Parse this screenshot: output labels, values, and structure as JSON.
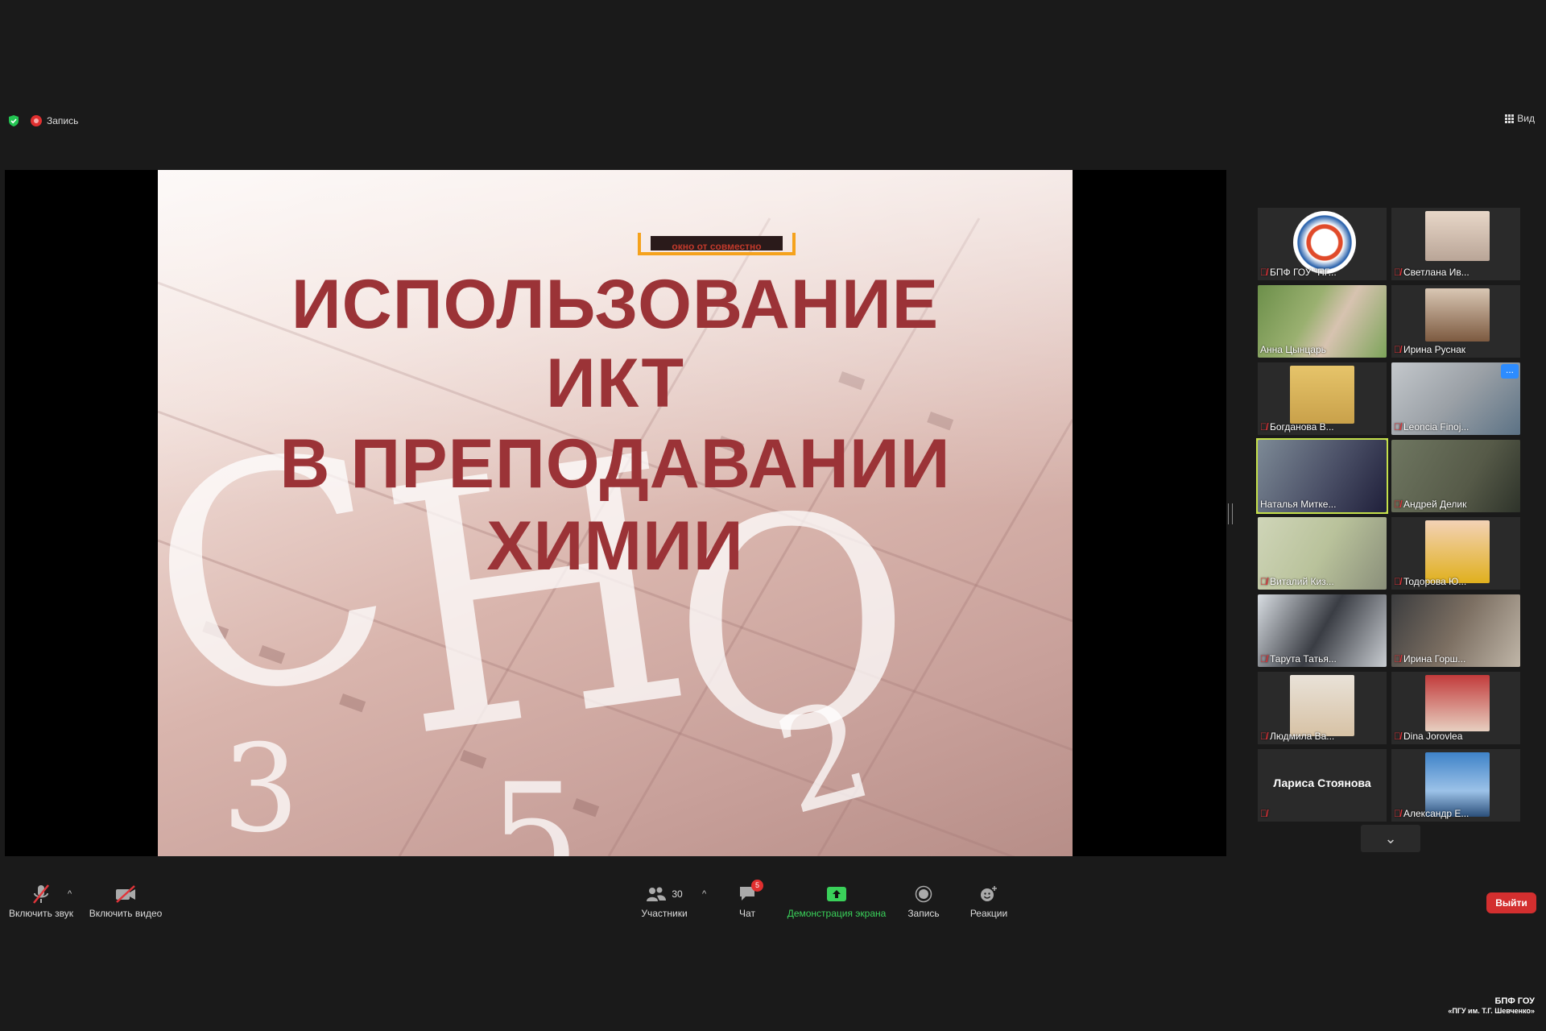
{
  "topbar": {
    "recording_label": "Запись",
    "view_label": "Вид"
  },
  "slide": {
    "banner_text": "окно от совместно",
    "title_lines": [
      "ИСПОЛЬЗОВАНИЕ",
      "ИКТ",
      "В ПРЕПОДАВАНИИ",
      "ХИМИИ"
    ],
    "title_color": "#9b3337"
  },
  "gallery": {
    "tiles": [
      {
        "name": "БПФ ГОУ \"ПГ...",
        "muted": true
      },
      {
        "name": "Светлана Ив...",
        "muted": true
      },
      {
        "name": "Анна Цынцарь",
        "muted": false
      },
      {
        "name": "Ирина Руснак",
        "muted": true
      },
      {
        "name": "Богданова В...",
        "muted": true
      },
      {
        "name": "Leoncia Finoj...",
        "muted": true
      },
      {
        "name": "Наталья Митке...",
        "muted": false
      },
      {
        "name": "Андрей Делик",
        "muted": true
      },
      {
        "name": "Виталий Киз...",
        "muted": true
      },
      {
        "name": "Тодорова Ю...",
        "muted": true
      },
      {
        "name": "Тарута Татья...",
        "muted": true
      },
      {
        "name": "Ирина Горш...",
        "muted": true
      },
      {
        "name": "Людмила Ва...",
        "muted": true
      },
      {
        "name": "Dina Jorovlea",
        "muted": true
      },
      {
        "name": "Лариса Стоянова",
        "muted": true
      },
      {
        "name": "Александр Е...",
        "muted": true
      }
    ],
    "more_dots": "..."
  },
  "toolbar": {
    "unmute_label": "Включить звук",
    "video_label": "Включить видео",
    "participants_label": "Участники",
    "participants_count": "30",
    "chat_label": "Чат",
    "chat_badge": "5",
    "share_label": "Демонстрация экрана",
    "record_label": "Запись",
    "reactions_label": "Реакции",
    "leave_label": "Выйти",
    "share_color": "#3ad15a",
    "leave_color": "#d32f2f"
  },
  "watermark": {
    "line1": "БПФ ГОУ",
    "line2": "«ПГУ им. Т.Г. Шевченко»"
  }
}
